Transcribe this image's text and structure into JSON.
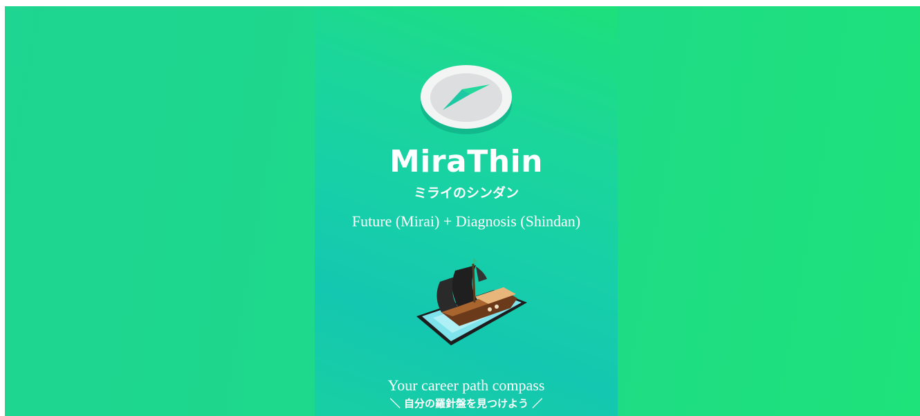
{
  "app": {
    "brand_name": "MiraThin",
    "brand_reading": "ミライのシンダン",
    "tagline": "Future (Mirai) + Diagnosis (Shindan)",
    "career_caption": "Your career path compass",
    "japanese_caption": "＼ 自分の羅針盤を見つけよう ／"
  },
  "icons": {
    "logo": "compass-icon",
    "illustration": "ship-on-tablet-illustration"
  },
  "colors": {
    "background_gradient_start": "#1ed591",
    "background_gradient_end": "#1ee27a",
    "panel_gradient_top": "#1de07a",
    "panel_gradient_bottom": "#14c7b0",
    "text": "#ffffff"
  }
}
